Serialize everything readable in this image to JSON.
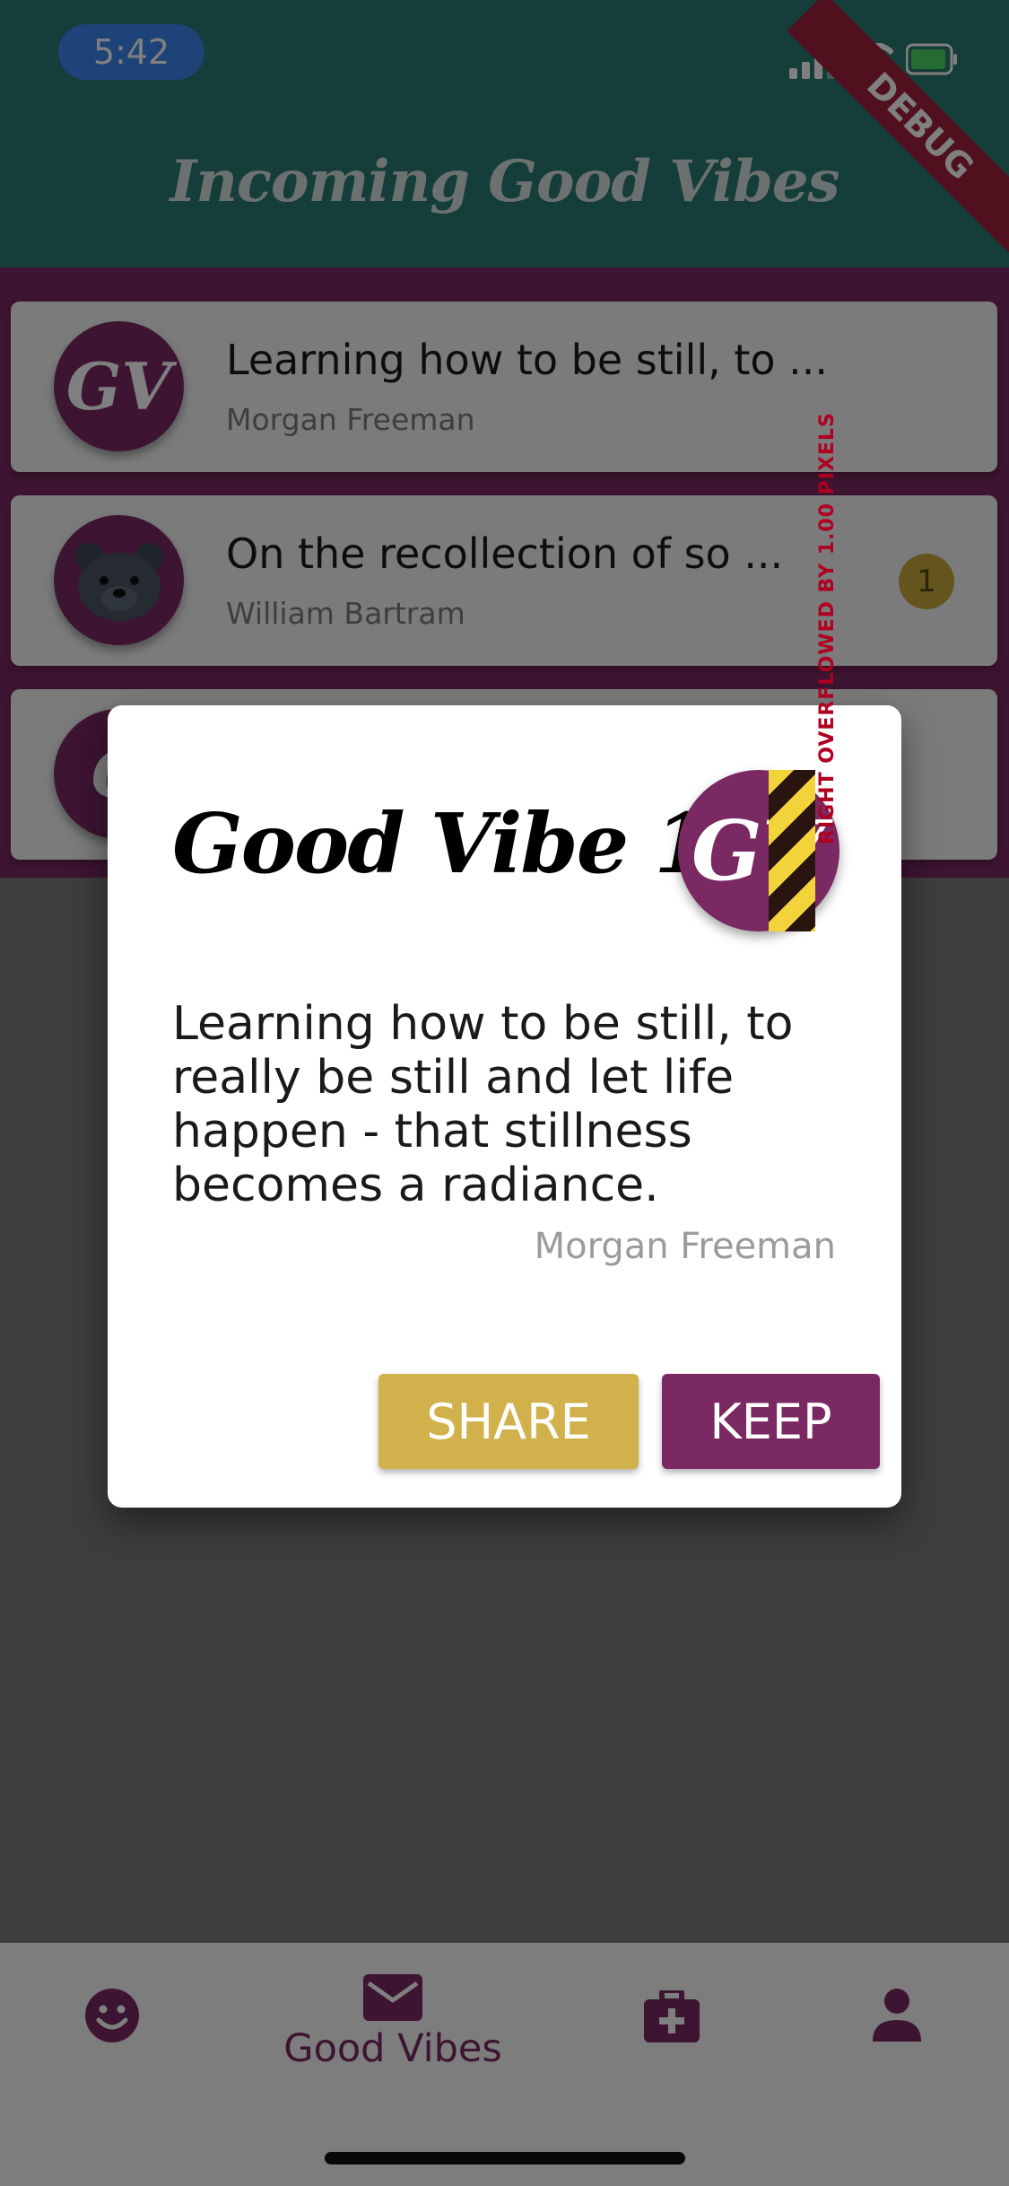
{
  "status_bar": {
    "time": "5:42"
  },
  "app_bar": {
    "title": "Incoming Good Vibes",
    "debug_label": "DEBUG"
  },
  "list": {
    "items": [
      {
        "avatar_text": "GV",
        "title": "Learning how to be still, to ...",
        "author": "Morgan Freeman",
        "badge": ""
      },
      {
        "avatar_text": "",
        "title": "On the recollection of so ...",
        "author": "William Bartram",
        "badge": "1"
      },
      {
        "avatar_text": "G",
        "title": "",
        "author": "",
        "badge": ""
      }
    ]
  },
  "dialog": {
    "title": "Good Vibe 109",
    "avatar_text": "GV",
    "overflow_warning": "RIGHT OVERFLOWED BY 1.00 PIXELS",
    "quote": "Learning how to be still, to really be still and let life happen - that stillness becomes a radiance.",
    "author": "Morgan Freeman",
    "share_label": "SHARE",
    "keep_label": "KEEP"
  },
  "bottom_nav": {
    "active_label": "Good Vibes",
    "items": [
      "smiley-icon",
      "mail-icon",
      "medical-kit-icon",
      "person-icon"
    ]
  },
  "colors": {
    "primary": "#7a2962",
    "app_bar": "#2a7a72",
    "accent_gold": "#d1b14c",
    "time_pill": "#3b87f0"
  }
}
